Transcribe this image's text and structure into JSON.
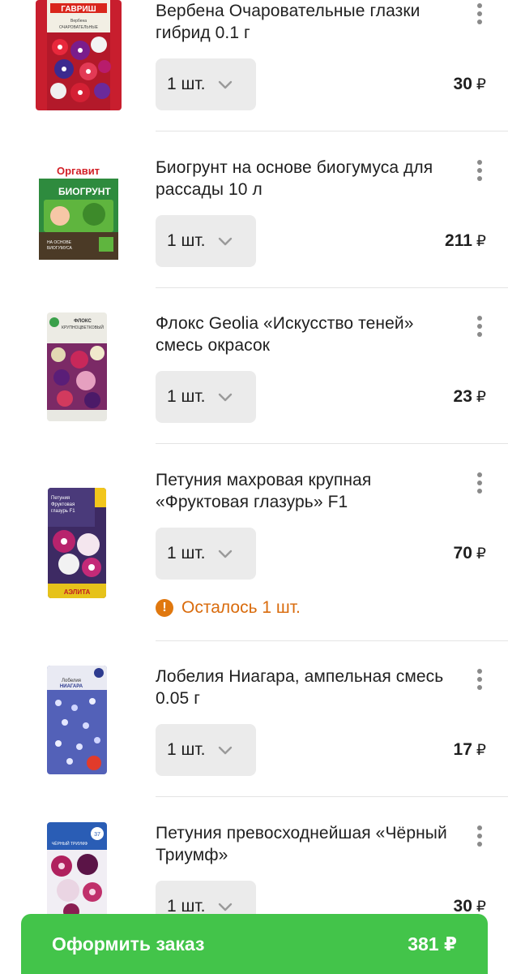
{
  "cart": {
    "items": [
      {
        "title": "Вербена Очаровательные глазки гибрид 0.1 г",
        "qty": "1 шт.",
        "price": "30",
        "currency": "₽",
        "thumb": "verbena-seed-pack"
      },
      {
        "title": "Биогрунт на основе биогумуса для рассады 10 л",
        "qty": "1 шт.",
        "price": "211",
        "currency": "₽",
        "thumb": "biogrunt-soil-bag"
      },
      {
        "title": "Флокс Geolia «Искусство теней» смесь окрасок",
        "qty": "1 шт.",
        "price": "23",
        "currency": "₽",
        "thumb": "phlox-seed-pack"
      },
      {
        "title": "Петуния махровая крупная «Фруктовая глазурь» F1",
        "qty": "1 шт.",
        "price": "70",
        "currency": "₽",
        "thumb": "petunia-fruit-glaze-seed-pack",
        "warning": "Осталось 1 шт."
      },
      {
        "title": "Лобелия Ниагара, ампельная смесь 0.05 г",
        "qty": "1 шт.",
        "price": "17",
        "currency": "₽",
        "thumb": "lobelia-seed-pack"
      },
      {
        "title": "Петуния превосходнейшая «Чёрный Триумф»",
        "qty": "1 шт.",
        "price": "30",
        "currency": "₽",
        "thumb": "petunia-black-triumph-seed-pack"
      }
    ]
  },
  "checkout": {
    "label": "Оформить заказ",
    "total": "381 ₽"
  },
  "colors": {
    "accent": "#43c44a",
    "warning": "#e0780f",
    "qty_bg": "#ebebeb",
    "divider": "#e4e4e4"
  }
}
